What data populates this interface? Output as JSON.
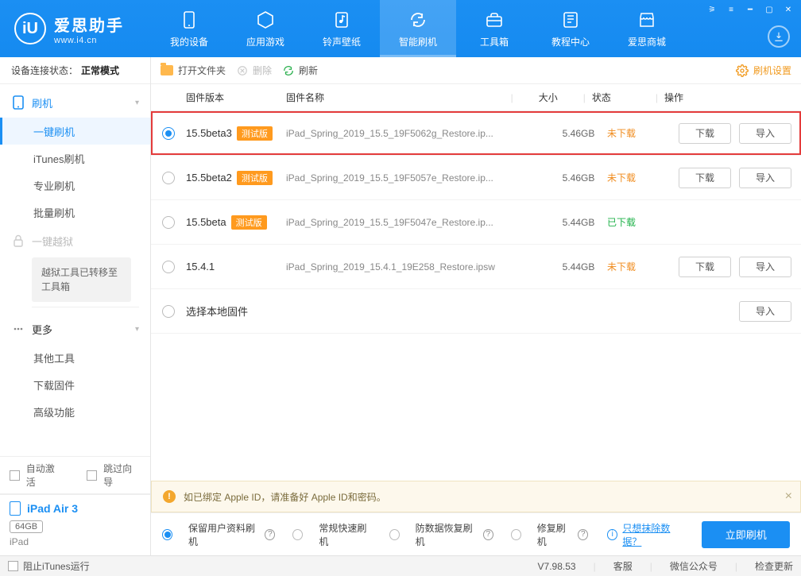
{
  "window": {
    "app_name": "爱思助手",
    "site": "www.i4.cn",
    "logo_letters": "iU"
  },
  "top_nav": [
    {
      "label": "我的设备",
      "icon": "device"
    },
    {
      "label": "应用游戏",
      "icon": "apps"
    },
    {
      "label": "铃声壁纸",
      "icon": "music"
    },
    {
      "label": "智能刷机",
      "icon": "refresh",
      "active": true
    },
    {
      "label": "工具箱",
      "icon": "toolbox"
    },
    {
      "label": "教程中心",
      "icon": "book"
    },
    {
      "label": "爱思商城",
      "icon": "store"
    }
  ],
  "connection": {
    "label": "设备连接状态：",
    "mode": "正常模式"
  },
  "sidebar": {
    "head_flash": "刷机",
    "items_flash": [
      "一键刷机",
      "iTunes刷机",
      "专业刷机",
      "批量刷机"
    ],
    "active": "一键刷机",
    "head_jail": "一键越狱",
    "jail_note": "越狱工具已转移至工具箱",
    "head_more": "更多",
    "items_more": [
      "其他工具",
      "下载固件",
      "高级功能"
    ]
  },
  "auto": {
    "activate": "自动激活",
    "skip": "跳过向导"
  },
  "device": {
    "name": "iPad Air 3",
    "capacity": "64GB",
    "type": "iPad"
  },
  "toolbar": {
    "open": "打开文件夹",
    "delete": "删除",
    "refresh": "刷新",
    "settings": "刷机设置"
  },
  "table": {
    "head": {
      "version": "固件版本",
      "name": "固件名称",
      "size": "大小",
      "state": "状态",
      "action": "操作"
    },
    "download_btn": "下载",
    "import_btn": "导入",
    "local_select": "选择本地固件",
    "rows": [
      {
        "version": "15.5beta3",
        "beta": true,
        "name": "iPad_Spring_2019_15.5_19F5062g_Restore.ip...",
        "size": "5.46GB",
        "state": "未下载",
        "state_cls": "un",
        "selected": true,
        "highlight": true
      },
      {
        "version": "15.5beta2",
        "beta": true,
        "name": "iPad_Spring_2019_15.5_19F5057e_Restore.ip...",
        "size": "5.46GB",
        "state": "未下载",
        "state_cls": "un",
        "selected": false
      },
      {
        "version": "15.5beta",
        "beta": true,
        "name": "iPad_Spring_2019_15.5_19F5047e_Restore.ip...",
        "size": "5.44GB",
        "state": "已下载",
        "state_cls": "done",
        "selected": false
      },
      {
        "version": "15.4.1",
        "beta": false,
        "name": "iPad_Spring_2019_15.4.1_19E258_Restore.ipsw",
        "size": "5.44GB",
        "state": "未下载",
        "state_cls": "un",
        "selected": false
      }
    ]
  },
  "tip": "如已绑定 Apple ID，请准备好 Apple ID和密码。",
  "options": {
    "keep_data": "保留用户资料刷机",
    "normal": "常规快速刷机",
    "anti": "防数据恢复刷机",
    "repair": "修复刷机",
    "erase_link": "只想抹除数据？",
    "go": "立即刷机"
  },
  "statusbar": {
    "block_itunes": "阻止iTunes运行",
    "version": "V7.98.53",
    "service": "客服",
    "wechat": "微信公众号",
    "update": "检查更新"
  },
  "beta_tag_text": "测试版"
}
